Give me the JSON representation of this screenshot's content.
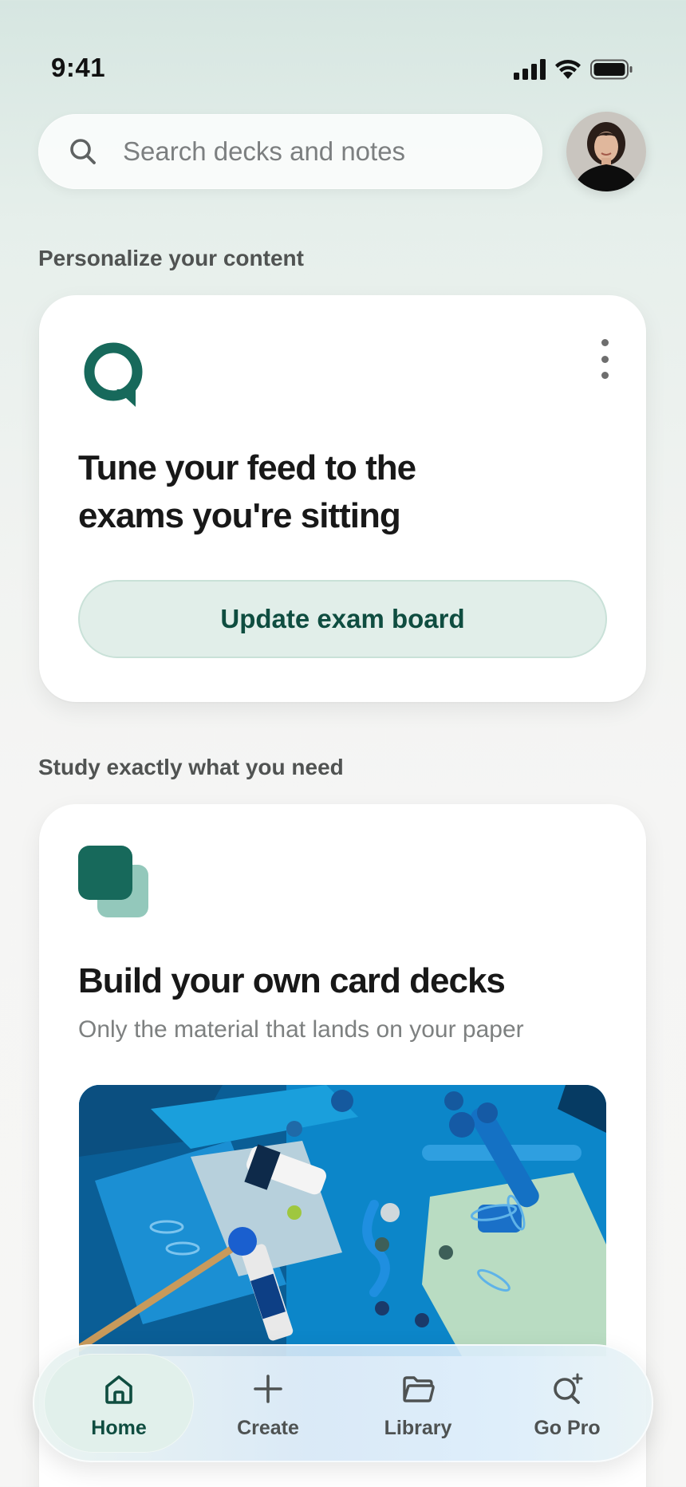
{
  "status_bar": {
    "time": "9:41"
  },
  "search": {
    "placeholder": "Search decks and notes"
  },
  "sections": {
    "personalize": {
      "label": "Personalize your content",
      "card": {
        "title_line1": "Tune your feed to the",
        "title_line2": "exams you're sitting",
        "button_label": "Update exam board"
      }
    },
    "study": {
      "label": "Study exactly what you need",
      "card": {
        "title": "Build your own card decks",
        "subtitle": "Only the material that lands on your paper"
      }
    }
  },
  "tab_bar": {
    "items": [
      {
        "label": "Home",
        "icon": "home-icon",
        "active": true
      },
      {
        "label": "Create",
        "icon": "plus-icon",
        "active": false
      },
      {
        "label": "Library",
        "icon": "folder-icon",
        "active": false
      },
      {
        "label": "Go Pro",
        "icon": "search-sparkle-icon",
        "active": false
      }
    ]
  },
  "colors": {
    "brand": "#17695b",
    "brand_dark": "#0f4d40",
    "brand_light": "#e1eee9"
  }
}
